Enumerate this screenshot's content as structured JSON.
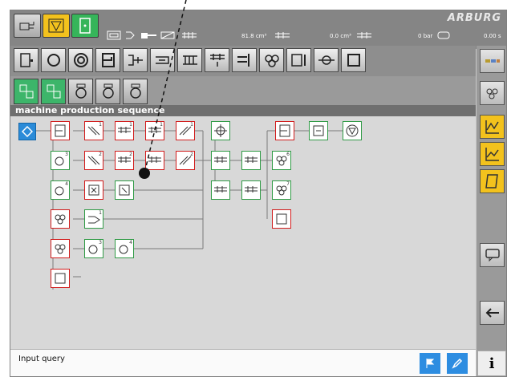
{
  "brand": "ARBURG",
  "status": {
    "value1": "81.8",
    "unit1": "cm³",
    "value2": "0.0",
    "unit2": "cm³",
    "value3": "0",
    "unit3": "bar",
    "value4": "0.00",
    "unit4": "s"
  },
  "section_header": "machine production sequence",
  "input_bar": {
    "label": "Input query"
  },
  "info_button": "i",
  "step_numbers": [
    "1",
    "1",
    "1",
    "1",
    "3",
    "2",
    "2",
    "2",
    "2",
    "4",
    "1",
    "1",
    "1",
    "6",
    "7",
    "1",
    "3",
    "4"
  ],
  "colors": {
    "accent_yellow": "#f3c21d",
    "accent_green": "#36b55a",
    "step_border": "#d11c1c",
    "start_blue": "#2b8bd8"
  }
}
